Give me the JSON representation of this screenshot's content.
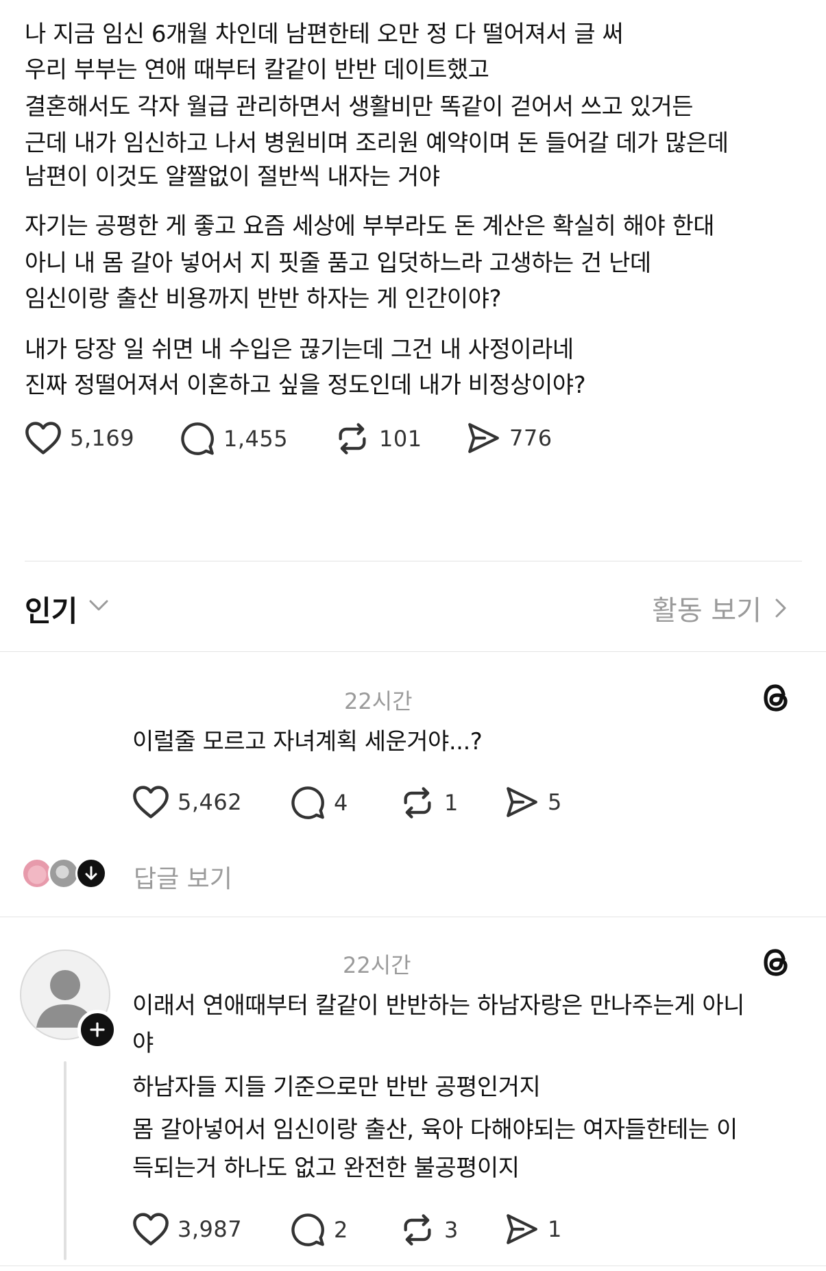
{
  "post": {
    "paragraph1": [
      "나 지금 임신 6개월 차인데 남편한테 오만 정 다 떨어져서 글 써",
      "우리 부부는 연애 때부터 칼같이 반반 데이트했고",
      "결혼해서도 각자 월급 관리하면서 생활비만 똑같이 걷어서 쓰고 있거든",
      "근데 내가 임신하고 나서 병원비며 조리원 예약이며 돈 들어갈 데가 많은데",
      "남편이 이것도 얄짤없이 절반씩 내자는 거야"
    ],
    "paragraph2": [
      "자기는 공평한 게 좋고 요즘 세상에 부부라도 돈 계산은 확실히 해야 한대",
      "아니 내 몸 갈아 넣어서 지 핏줄 품고 입덧하느라 고생하는 건 난데",
      "임신이랑 출산 비용까지 반반 하자는 게 인간이야?"
    ],
    "paragraph3": [
      "내가 당장 일 쉬면 내 수입은 끊기는데 그건 내 사정이라네",
      "진짜 정떨어져서 이혼하고 싶을 정도인데 내가 비정상이야?"
    ],
    "stats": {
      "likes": "5,169",
      "comments": "1,455",
      "reposts": "101",
      "shares": "776"
    }
  },
  "sort": {
    "label": "인기",
    "activity_label": "활동 보기"
  },
  "comments": [
    {
      "time": "22시간",
      "lines": [
        "이럴줄 모르고 자녀계획 세운거야...?"
      ],
      "stats": {
        "likes": "5,462",
        "comments": "4",
        "reposts": "1",
        "shares": "5"
      },
      "view_replies": "답글 보기"
    },
    {
      "time": "22시간",
      "lines": [
        "이래서 연애때부터 칼같이 반반하는 하남자랑은 만나주는게 아니",
        "야",
        "하남자들 지들 기준으로만 반반 공평인거지",
        "몸 갈아넣어서 임신이랑 출산, 육아 다해야되는 여자들한테는  이",
        "득되는거 하나도 없고 완전한 불공평이지"
      ],
      "stats": {
        "likes": "3,987",
        "comments": "2",
        "reposts": "3",
        "shares": "1"
      }
    }
  ],
  "colors": {
    "text": "#111111",
    "muted": "#9a9a9a",
    "divider": "#e4e4e4",
    "icon": "#333333"
  },
  "icons": [
    "heart-icon",
    "comment-icon",
    "repost-icon",
    "share-icon",
    "chevron-down-icon",
    "chevron-right-icon",
    "threads-logo-icon",
    "add-icon",
    "arrow-down-icon"
  ]
}
